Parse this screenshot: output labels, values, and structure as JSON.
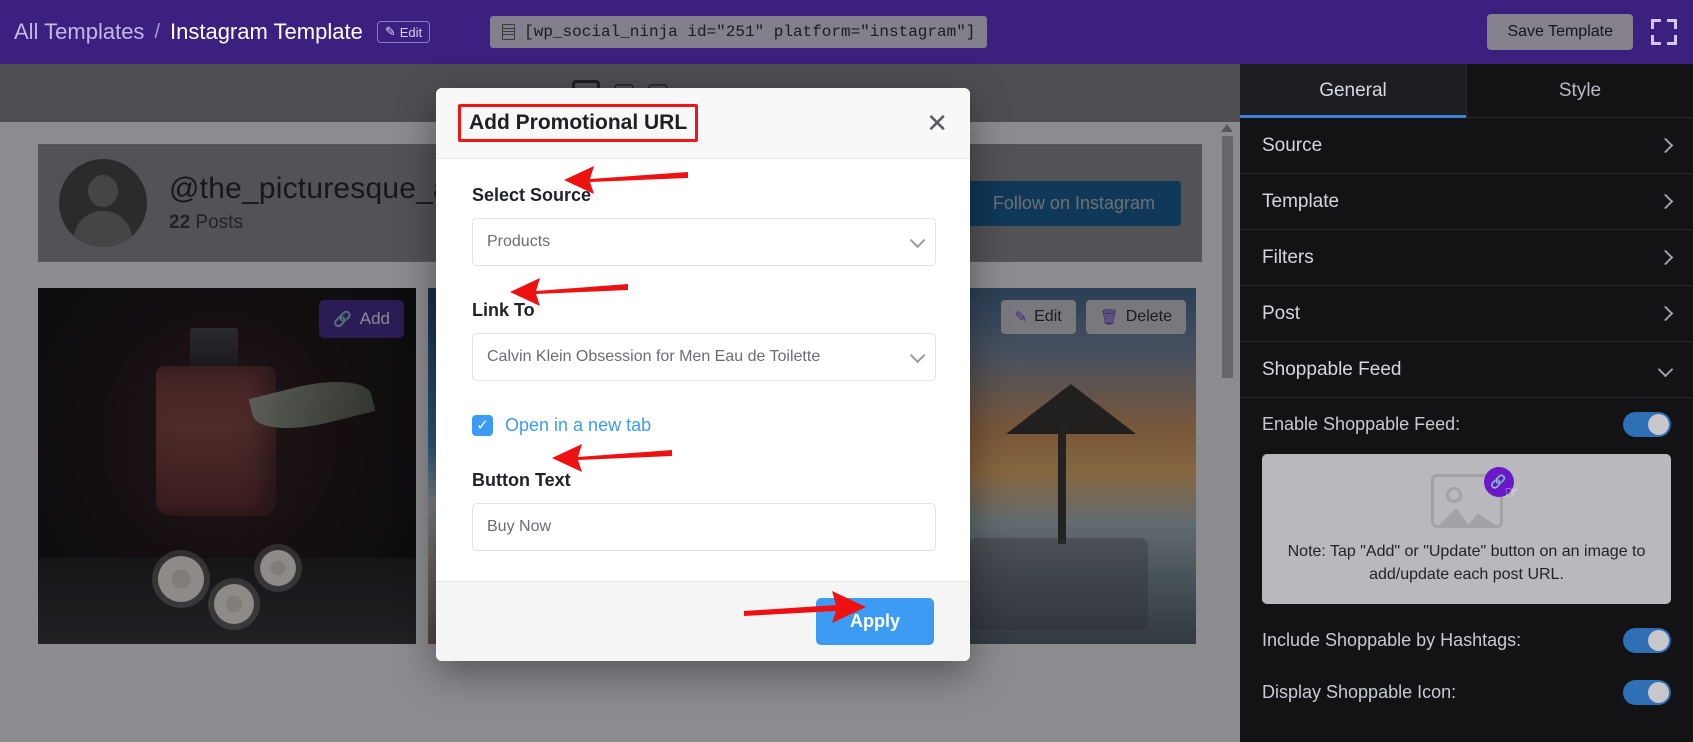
{
  "topbar": {
    "breadcrumb_root": "All Templates",
    "breadcrumb_sep": "/",
    "breadcrumb_current": "Instagram Template",
    "edit_chip": "Edit",
    "shortcode": "[wp_social_ninja id=\"251\" platform=\"instagram\"]",
    "save_label": "Save Template",
    "accent": "#3b2080"
  },
  "feed": {
    "handle": "@the_picturesque_art",
    "posts_count": "22",
    "posts_label": "Posts",
    "follow_label": "Follow on Instagram",
    "add_label": "Add",
    "edit_label": "Edit",
    "delete_label": "Delete"
  },
  "modal": {
    "title": "Add Promotional URL",
    "close": "✕",
    "source_label": "Select Source",
    "source_value": "Products",
    "link_label": "Link To",
    "link_value": "Calvin Klein Obsession for Men Eau de Toilette",
    "newtab_label": "Open in a new tab",
    "newtab_checked": true,
    "button_text_label": "Button Text",
    "button_text_value": "Buy Now",
    "apply_label": "Apply",
    "highlight_color": "#f01616",
    "accent_blue": "#3e9bf4"
  },
  "sidebar": {
    "tabs": [
      {
        "label": "General",
        "active": true
      },
      {
        "label": "Style",
        "active": false
      }
    ],
    "sections": [
      {
        "label": "Source",
        "open": false
      },
      {
        "label": "Template",
        "open": false
      },
      {
        "label": "Filters",
        "open": false
      },
      {
        "label": "Post",
        "open": false
      },
      {
        "label": "Shoppable Feed",
        "open": true
      }
    ],
    "settings": [
      {
        "label": "Enable Shoppable Feed:",
        "on": true
      },
      {
        "label": "Include Shoppable by Hashtags:",
        "on": true
      },
      {
        "label": "Display Shoppable Icon:",
        "on": true
      }
    ],
    "note": "Note: Tap \"Add\" or \"Update\" button on an image to add/update each post URL.",
    "toggle_on_color": "#2f6fb5"
  }
}
